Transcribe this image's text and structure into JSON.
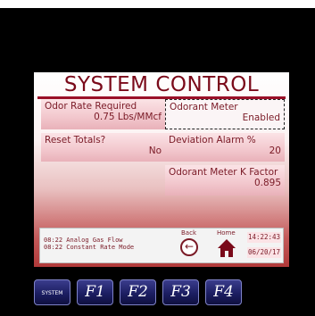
{
  "screen": {
    "title": "SYSTEM CONTROL",
    "odor_rate": {
      "label": "Odor Rate Required",
      "value": "0.75 Lbs/MMcf"
    },
    "odorant_meter": {
      "label": "Odorant Meter",
      "value": "Enabled"
    },
    "reset_totals": {
      "label": "Reset Totals?",
      "value": "No"
    },
    "deviation_alarm": {
      "label": "Deviation Alarm %",
      "value": "20"
    },
    "k_factor": {
      "label": "Odorant Meter K Factor",
      "value": "0.895"
    }
  },
  "status": {
    "messages": [
      "08:22 Analog Gas Flow",
      "08:22 Constant Rate Mode"
    ],
    "back_label": "Back",
    "home_label": "Home",
    "time": "14:22:43",
    "date": "06/20/17"
  },
  "softkeys": [
    "SYSTEM",
    "F1",
    "F2",
    "F3",
    "F4"
  ],
  "colors": {
    "accent": "#9a1028",
    "softkey": "#1c1e62"
  }
}
